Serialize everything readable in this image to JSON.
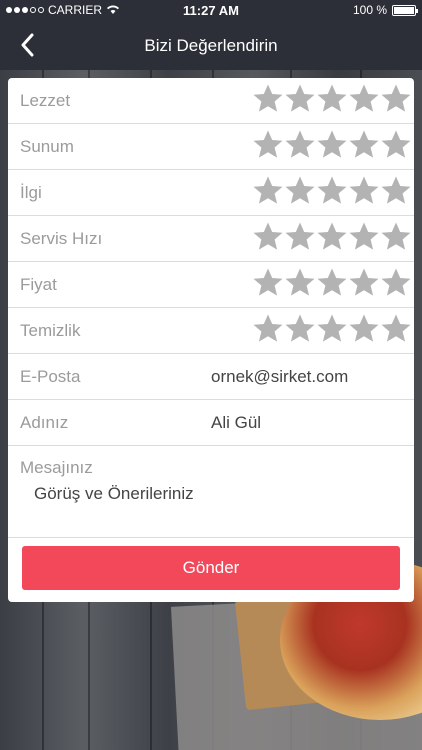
{
  "status_bar": {
    "carrier": "CARRIER",
    "time": "11:27 AM",
    "battery": "100 %"
  },
  "nav": {
    "title": "Bizi Değerlendirin"
  },
  "ratings": [
    {
      "label": "Lezzet",
      "stars": 0,
      "max": 5
    },
    {
      "label": "Sunum",
      "stars": 0,
      "max": 5
    },
    {
      "label": "İlgi",
      "stars": 0,
      "max": 5
    },
    {
      "label": "Servis Hızı",
      "stars": 0,
      "max": 5
    },
    {
      "label": "Fiyat",
      "stars": 0,
      "max": 5
    },
    {
      "label": "Temizlik",
      "stars": 0,
      "max": 5
    }
  ],
  "fields": {
    "email_label": "E-Posta",
    "email_placeholder": "ornek@sirket.com",
    "name_label": "Adınız",
    "name_value": "Ali Gül",
    "message_label": "Mesajınız",
    "message_placeholder": "Görüş ve Önerileriniz"
  },
  "send_button": {
    "label": "Gönder"
  },
  "colors": {
    "accent": "#f2485a",
    "star_empty": "#b3b3b3",
    "nav_bg": "#2d2f38"
  },
  "icons": {
    "back": "chevron-left-icon",
    "star": "star-icon",
    "wifi": "wifi-icon",
    "battery": "battery-icon"
  }
}
